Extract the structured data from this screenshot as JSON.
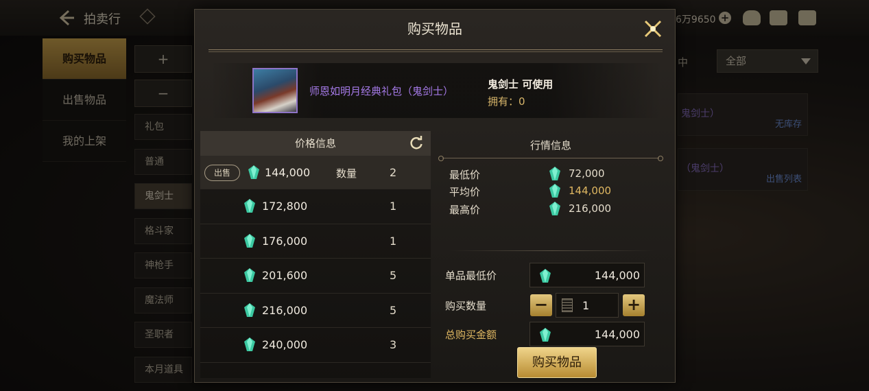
{
  "topbar": {
    "title": "拍卖行",
    "currency": "6万9650"
  },
  "left_nav": {
    "items": [
      {
        "label": "购买物品"
      },
      {
        "label": "出售物品"
      },
      {
        "label": "我的上架"
      }
    ]
  },
  "categories": {
    "plus": "+",
    "minus": "−",
    "items": [
      "礼包",
      "普通",
      "鬼剑士",
      "格斗家",
      "神枪手",
      "魔法师",
      "圣职者",
      "本月道具"
    ]
  },
  "bg_right": {
    "filter_label": "中",
    "dropdown_value": "全部",
    "card1_text": "鬼剑士）",
    "card1_status": "无库存",
    "card2_text": "（鬼剑士）",
    "card2_status": "出售列表"
  },
  "modal": {
    "title": "购买物品",
    "item": {
      "name": "师恩如明月经典礼包（鬼剑士）",
      "job_usable": "鬼剑士 可使用",
      "owned": "拥有：0"
    },
    "price_panel": {
      "header": "价格信息",
      "sell_badge": "出售",
      "qty_label": "数量",
      "rows": [
        {
          "price": "144,000",
          "qty": "2"
        },
        {
          "price": "172,800",
          "qty": "1"
        },
        {
          "price": "176,000",
          "qty": "1"
        },
        {
          "price": "201,600",
          "qty": "5"
        },
        {
          "price": "216,000",
          "qty": "5"
        },
        {
          "price": "240,000",
          "qty": "3"
        }
      ]
    },
    "market": {
      "header": "行情信息",
      "min_label": "最低价",
      "min_value": "72,000",
      "avg_label": "平均价",
      "avg_value": "144,000",
      "max_label": "最高价",
      "max_value": "216,000"
    },
    "form": {
      "unit_min_label": "单品最低价",
      "unit_min_value": "144,000",
      "qty_label": "购买数量",
      "qty_value": "1",
      "total_label": "总购买金额",
      "total_value": "144,000",
      "buy_button": "购买物品"
    }
  },
  "colors": {
    "gold": "#e0b862",
    "purple_item": "#a57ae8",
    "gem": "#3cc9a2"
  }
}
